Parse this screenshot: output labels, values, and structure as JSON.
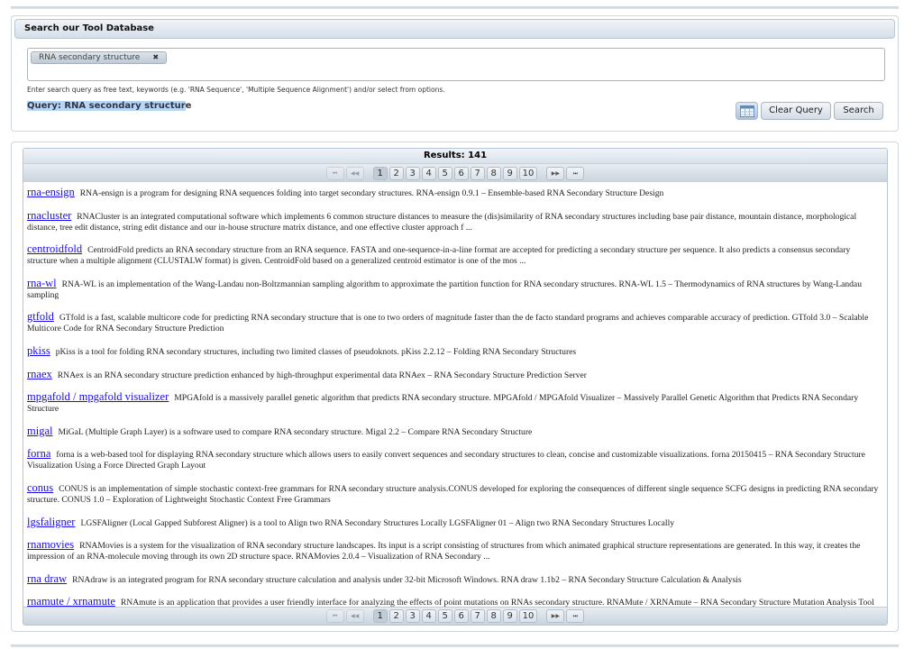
{
  "search": {
    "title": "Search our Tool Database",
    "chip": "RNA secondary structure",
    "chip_remove": "✖",
    "help": "Enter search query as free text, keywords (e.g. 'RNA Sequence', 'Multiple Sequence Alignment') and/or select from options.",
    "query_highlight": "Query: RNA secondary structur",
    "query_rest": "e",
    "table_icon": "table-icon",
    "clear_label": "Clear Query",
    "search_label": "Search"
  },
  "results": {
    "title": "Results: 141",
    "pages": [
      "1",
      "2",
      "3",
      "4",
      "5",
      "6",
      "7",
      "8",
      "9",
      "10"
    ],
    "current_page": "1",
    "first": "⏮",
    "prev": "◀◀",
    "next": "▶▶",
    "last": "⏭",
    "items": [
      {
        "name": "rna-ensign",
        "desc": "RNA-ensign is a program for designing RNA sequences folding into target secondary structures. RNA-ensign 0.9.1 – Ensemble-based RNA Secondary Structure Design"
      },
      {
        "name": "rnacluster",
        "desc": "RNACluster is an integrated computational software which implements 6 common structure distances to measure the (dis)similarity of RNA secondary structures including base pair distance, mountain distance, morphological distance, tree edit distance, string edit distance and our in-house structure matrix distance, and one effective cluster approach f ..."
      },
      {
        "name": "centroidfold",
        "desc": "CentroidFold predicts an RNA secondary structure from an RNA sequence. FASTA and one-sequence-in-a-line format are accepted for predicting a secondary structure per sequence. It also predicts a consensus secondary structure when a multiple alignment (CLUSTALW format) is given. CentroidFold based on a generalized centroid estimator is one of the mos ..."
      },
      {
        "name": "rna-wl",
        "desc": "RNA-WL is an implementation of the Wang-Landau non-Boltzmannian sampling algorithm to approximate the partition function for RNA secondary structures. RNA-WL 1.5 – Thermodynamics of RNA structures by Wang-Landau sampling"
      },
      {
        "name": "gtfold",
        "desc": "GTfold is a fast, scalable multicore code for predicting RNA secondary structure that is one to two orders of magnitude faster than the de facto standard programs and achieves comparable accuracy of prediction. GTfold 3.0 – Scalable Multicore Code for RNA Secondary Structure Prediction"
      },
      {
        "name": "pkiss",
        "desc": "pKiss is a tool for folding RNA secondary structures, including two limited classes of pseudoknots. pKiss 2.2.12 – Folding RNA Secondary Structures"
      },
      {
        "name": "rnaex",
        "desc": "RNAex is an RNA secondary structure prediction enhanced by high-throughput experimental data RNAex – RNA Secondary Structure Prediction Server"
      },
      {
        "name": "mpgafold / mpgafold visualizer",
        "desc": "MPGAfold is a massively parallel genetic algorithm that predicts RNA secondary structure. MPGAfold / MPGAfold Visualizer – Massively Parallel Genetic Algorithm that Predicts RNA Secondary Structure"
      },
      {
        "name": "migal",
        "desc": "MiGaL (Multiple Graph Layer) is a software used to compare RNA secondary structure. Migal 2.2 – Compare RNA Secondary Structure"
      },
      {
        "name": "forna",
        "desc": "forna is a web-based tool for displaying RNA secondary structure which allows users to easily convert sequences and secondary structures to clean, concise and customizable visualizations. forna 20150415 – RNA Secondary Structure Visualization Using a Force Directed Graph Layout"
      },
      {
        "name": "conus",
        "desc": "CONUS is an implementation of simple stochastic context-free grammars for RNA secondary structure analysis.CONUS developed for exploring the consequences of different single sequence SCFG designs in predicting RNA secondary structure. CONUS 1.0 – Exploration of Lightweight Stochastic Context Free Grammars"
      },
      {
        "name": "lgsfaligner",
        "desc": "LGSFAligner (Local Gapped Subforest Aligner) is a tool to Align two RNA Secondary Structures Locally LGSFAligner 01 – Align two RNA Secondary Structures Locally"
      },
      {
        "name": "rnamovies",
        "desc": "RNAMovies is a system for the visualization of RNA secondary structure landscapes. Its input is a script consisting of structures from which animated graphical structure representations are generated. In this way, it creates the impression of an RNA-molecule moving through its own 2D structure space. RNAMovies 2.0.4 – Visualization of RNA Secondary ..."
      },
      {
        "name": "rna draw",
        "desc": "RNAdraw is an integrated program for RNA secondary structure calculation and analysis under 32-bit Microsoft Windows. RNA draw 1.1b2 – RNA Secondary Structure Calculation & Analysis"
      },
      {
        "name": "rnamute / xrnamute",
        "desc": "RNAmute is an application that provides a user friendly interface for analyzing the effects of point mutations on RNAs secondary structure. RNAMute / XRNAmute – RNA Secondary Structure Mutation Analysis Tool"
      }
    ]
  }
}
